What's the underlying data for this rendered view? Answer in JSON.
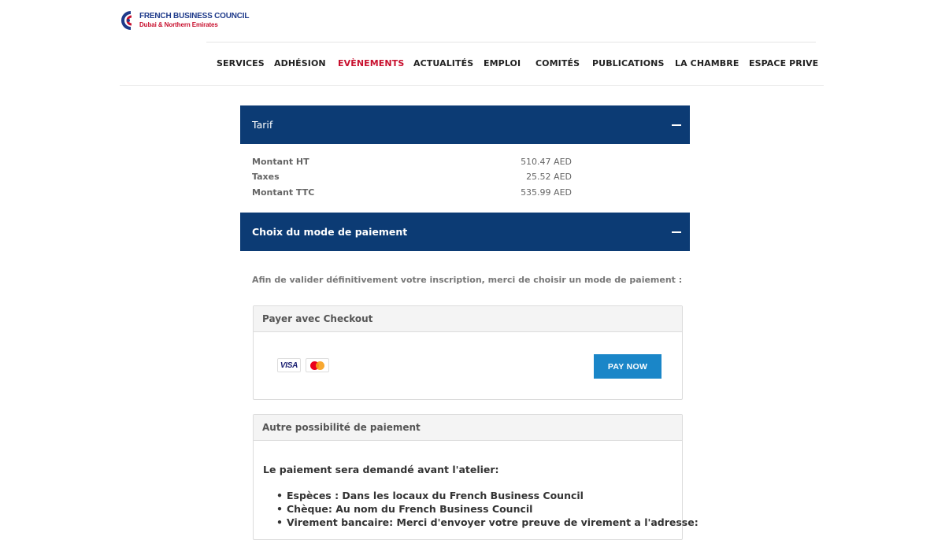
{
  "brand": {
    "line1": "FRENCH BUSINESS COUNCIL",
    "line2": "Dubai & Northern Emirates",
    "colors": {
      "navy": "#1e3a8a",
      "red": "#c8102e",
      "header_bar": "#0c3b74",
      "button": "#1a86c8"
    }
  },
  "nav": {
    "items": [
      {
        "label": "SERVICES"
      },
      {
        "label": "ADHÉSION"
      },
      {
        "label": "EVÈNEMENTS",
        "active": true
      },
      {
        "label": "ACTUALITÉS"
      },
      {
        "label": "EMPLOI"
      },
      {
        "label": "COMITÉS"
      },
      {
        "label": "PUBLICATIONS"
      },
      {
        "label": "LA CHAMBRE"
      },
      {
        "label": "ESPACE PRIVE"
      }
    ]
  },
  "tarif": {
    "title": "Tarif",
    "toggle_icon": "minus-icon",
    "rows": [
      {
        "label": "Montant HT",
        "value": "510.47 AED"
      },
      {
        "label": "Taxes",
        "value": "25.52 AED"
      },
      {
        "label": "Montant TTC",
        "value": "535.99 AED"
      }
    ]
  },
  "payment": {
    "title": "Choix du mode de paiement",
    "toggle_icon": "minus-icon",
    "intro": "Afin de valider définitivement votre inscription, merci de choisir un mode de paiement :",
    "checkout": {
      "header": "Payer avec Checkout",
      "cards": [
        "VISA",
        "mastercard-icon"
      ],
      "button_label": "PAY NOW"
    },
    "alternative": {
      "header": "Autre possibilité de paiement",
      "lead": "Le paiement sera demandé avant l'atelier:",
      "items": [
        "Espèces : Dans les locaux du French Business Council",
        "Chèque: Au nom du French Business Council",
        "Virement bancaire: Merci d'envoyer votre preuve de virement a l'adresse:"
      ]
    }
  }
}
